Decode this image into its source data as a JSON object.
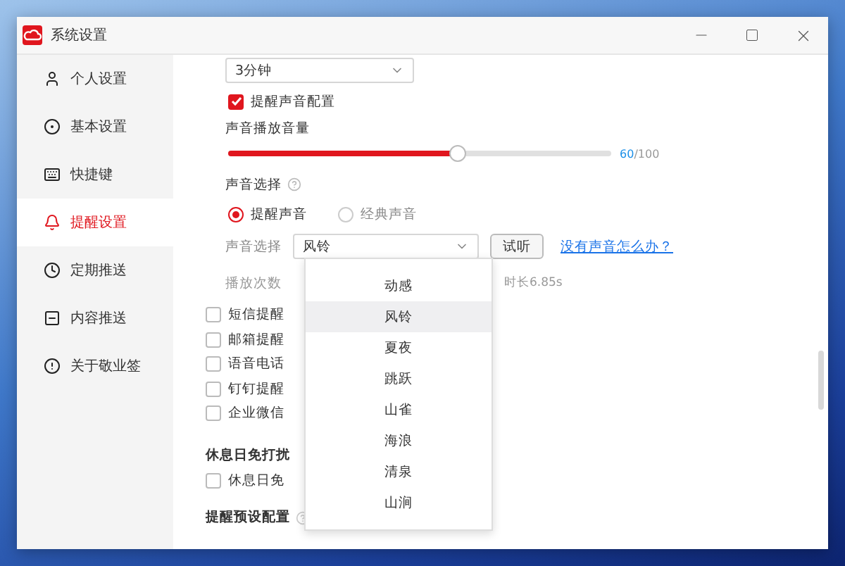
{
  "window": {
    "title": "系统设置"
  },
  "sidebar": {
    "items": [
      {
        "label": "个人设置",
        "selected": false
      },
      {
        "label": "基本设置",
        "selected": false
      },
      {
        "label": "快捷键",
        "selected": false
      },
      {
        "label": "提醒设置",
        "selected": true
      },
      {
        "label": "定期推送",
        "selected": false
      },
      {
        "label": "内容推送",
        "selected": false
      },
      {
        "label": "关于敬业签",
        "selected": false
      }
    ]
  },
  "interval_select": {
    "value": "3分钟"
  },
  "sound_config": {
    "label": "提醒声音配置",
    "checked": true
  },
  "volume": {
    "label": "声音播放音量",
    "level": 0.6,
    "value": "60",
    "max": "/100"
  },
  "sound_choice": {
    "heading": "声音选择",
    "options": [
      {
        "label": "提醒声音",
        "selected": true
      },
      {
        "label": "经典声音",
        "selected": false
      }
    ],
    "select_label": "声音选择",
    "select_value": "风铃",
    "test_button": "试听",
    "help_link": "没有声音怎么办？"
  },
  "play_count": {
    "label": "播放次数",
    "duration": "时长6.85s"
  },
  "channels": [
    {
      "label": "短信提醒",
      "checked": false
    },
    {
      "label": "邮箱提醒",
      "checked": false
    },
    {
      "label": "语音电话",
      "checked": false
    },
    {
      "label": "钉钉提醒",
      "checked": false
    },
    {
      "label": "企业微信",
      "checked": false
    }
  ],
  "rest_day": {
    "heading": "休息日免打扰",
    "option": {
      "label": "休息日免",
      "checked": false
    }
  },
  "preset": {
    "heading": "提醒预设配置"
  },
  "dropdown": {
    "items": [
      {
        "label": "动感",
        "selected": false
      },
      {
        "label": "风铃",
        "selected": true
      },
      {
        "label": "夏夜",
        "selected": false
      },
      {
        "label": "跳跃",
        "selected": false
      },
      {
        "label": "山雀",
        "selected": false
      },
      {
        "label": "海浪",
        "selected": false
      },
      {
        "label": "清泉",
        "selected": false
      },
      {
        "label": "山涧",
        "selected": false
      }
    ]
  }
}
